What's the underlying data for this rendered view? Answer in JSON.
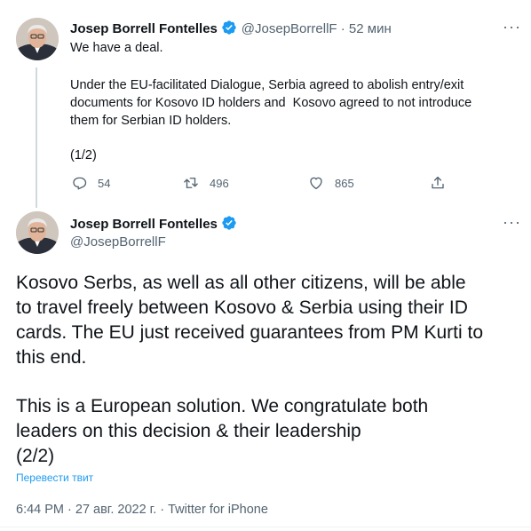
{
  "tweet1": {
    "author_name": "Josep Borrell Fontelles",
    "handle": "@JosepBorrellF",
    "time_sep": " · ",
    "time_ago": "52 мин",
    "line1": "We have a deal.",
    "body": "Under the EU-facilitated Dialogue, Serbia agreed to abolish entry/exit\ndocuments for Kosovo ID holders and  Kosovo agreed to not introduce\nthem for Serbian ID holders.",
    "counter": "(1/2)",
    "actions": {
      "replies": "54",
      "retweets": "496",
      "likes": "865"
    }
  },
  "tweet2": {
    "author_name": "Josep Borrell Fontelles",
    "handle": "@JosepBorrellF",
    "para1": "Kosovo Serbs, as well as all other citizens, will be able\nto travel freely between Kosovo & Serbia using their ID\ncards. The EU just received guarantees from PM Kurti to\nthis end.",
    "para2": "This is a European solution. We congratulate both\nleaders on this decision & their leadership\n(2/2)",
    "translate_label": "Перевести твит",
    "timestamp": "6:44 PM · 27 авг. 2022 г. · Twitter for iPhone"
  },
  "colors": {
    "accent": "#1d9bf0",
    "muted": "#536471",
    "text": "#0f1419"
  },
  "icons": [
    "reply-icon",
    "retweet-icon",
    "like-icon",
    "share-icon",
    "verified-badge-icon",
    "more-icon"
  ]
}
